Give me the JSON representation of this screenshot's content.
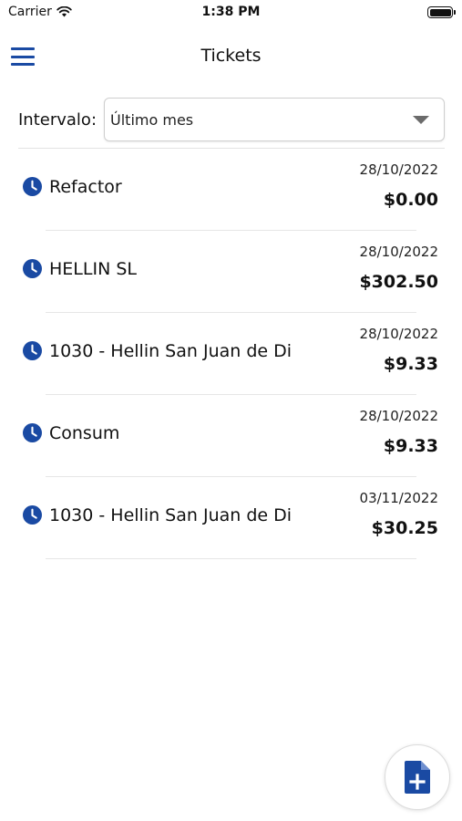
{
  "status_bar": {
    "carrier": "Carrier",
    "time": "1:38 PM",
    "wifi_icon": "wifi-icon",
    "battery_icon": "battery-full-icon"
  },
  "nav": {
    "title": "Tickets",
    "menu_icon": "hamburger-menu-icon"
  },
  "filter": {
    "label": "Intervalo:",
    "selected": "Último mes",
    "caret_icon": "caret-down-icon"
  },
  "tickets": [
    {
      "name": "Refactor",
      "date": "28/10/2022",
      "amount": "$0.00"
    },
    {
      "name": "HELLIN SL",
      "date": "28/10/2022",
      "amount": "$302.50"
    },
    {
      "name": "1030 - Hellin San Juan de Di",
      "date": "28/10/2022",
      "amount": "$9.33"
    },
    {
      "name": "Consum",
      "date": "28/10/2022",
      "amount": "$9.33"
    },
    {
      "name": "1030 - Hellin San Juan de Di",
      "date": "03/11/2022",
      "amount": "$30.25"
    }
  ],
  "fab": {
    "icon": "add-document-icon"
  },
  "colors": {
    "accent": "#1a4aa3",
    "divider": "#e6e6e6",
    "text": "#111111"
  }
}
